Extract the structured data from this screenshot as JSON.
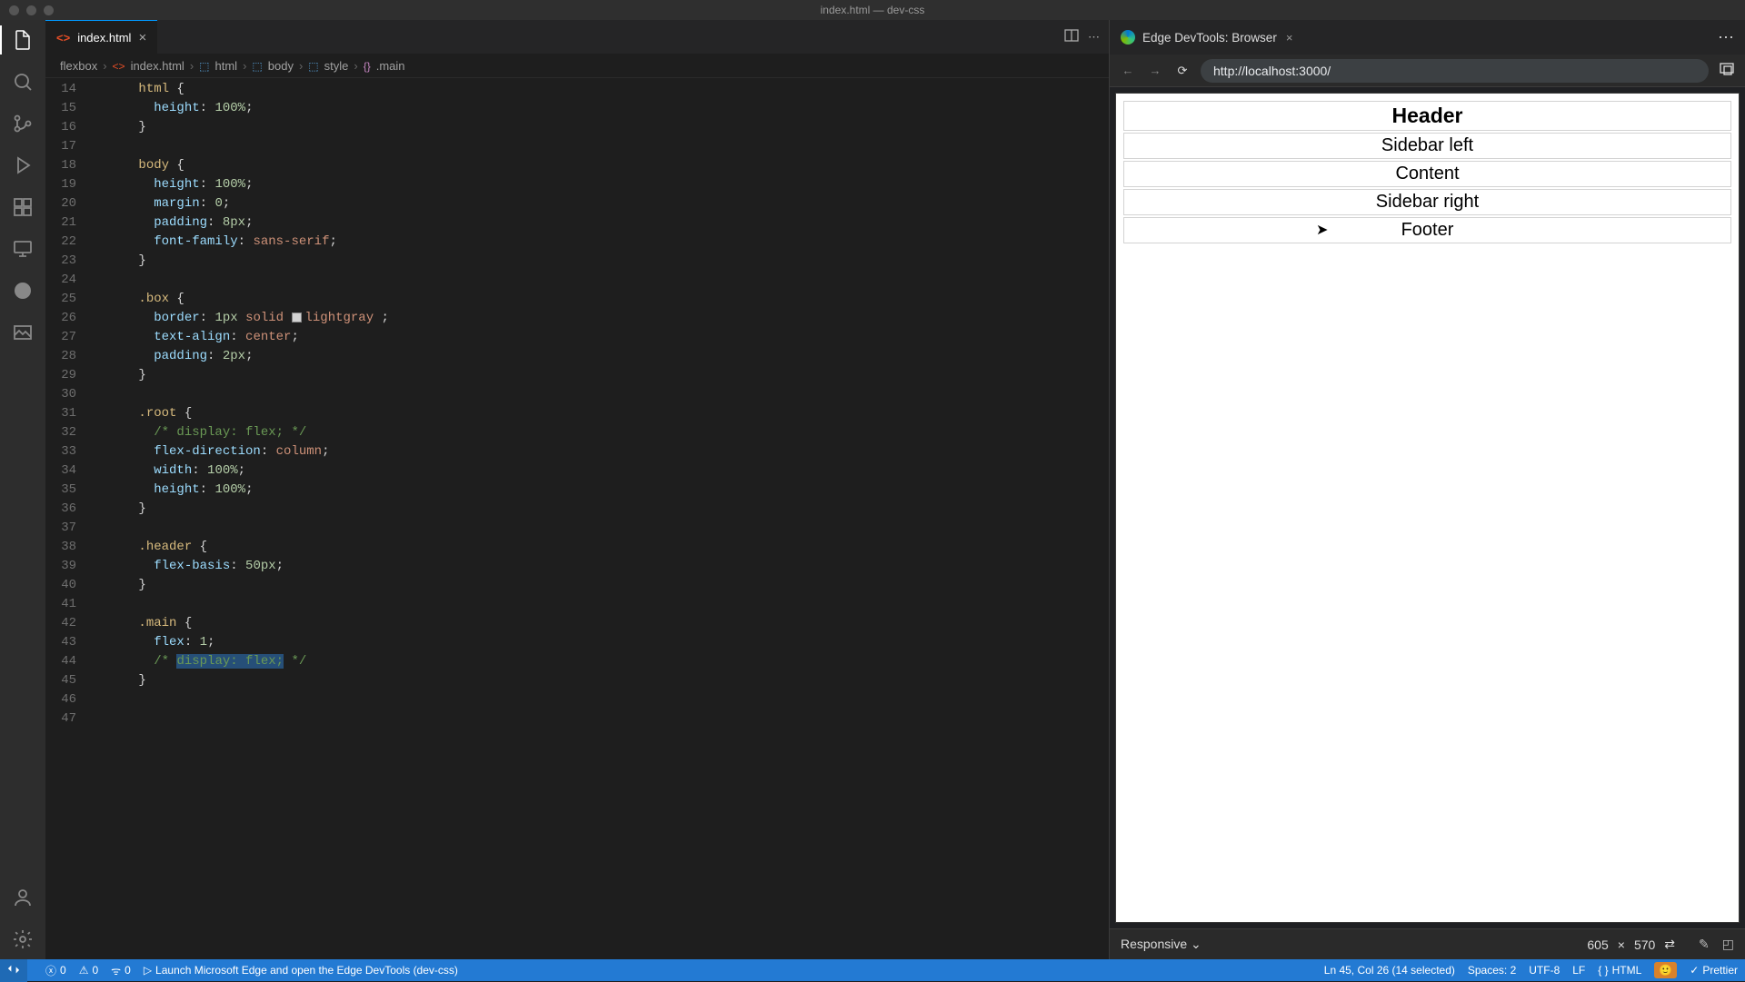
{
  "window": {
    "title": "index.html — dev-css"
  },
  "tab": {
    "filename": "index.html"
  },
  "breadcrumbs": {
    "root": "flexbox",
    "file": "index.html",
    "path": [
      "html",
      "body",
      "style",
      ".main"
    ]
  },
  "gutter": {
    "start": 14,
    "end": 47
  },
  "code_tokens": {
    "l14": {
      "sel": "html",
      "brace": " {"
    },
    "l15": {
      "prop": "height",
      "colon": ": ",
      "num": "100%",
      "semi": ";"
    },
    "l16": {
      "brace": "}"
    },
    "l18": {
      "sel": "body",
      "brace": " {"
    },
    "l19": {
      "prop": "height",
      "colon": ": ",
      "num": "100%",
      "semi": ";"
    },
    "l20": {
      "prop": "margin",
      "colon": ": ",
      "num": "0",
      "semi": ";"
    },
    "l21": {
      "prop": "padding",
      "colon": ": ",
      "num": "8px",
      "semi": ";"
    },
    "l22": {
      "prop": "font-family",
      "colon": ": ",
      "val": "sans-serif",
      "semi": ";"
    },
    "l23": {
      "brace": "}"
    },
    "l25": {
      "sel": ".box",
      "brace": " {"
    },
    "l26": {
      "prop": "border",
      "colon": ": ",
      "num": "1px",
      "val1": "solid",
      "val2": "lightgray",
      "semi": " ;"
    },
    "l27": {
      "prop": "text-align",
      "colon": ": ",
      "val": "center",
      "semi": ";"
    },
    "l28": {
      "prop": "padding",
      "colon": ": ",
      "num": "2px",
      "semi": ";"
    },
    "l29": {
      "brace": "}"
    },
    "l31": {
      "sel": ".root",
      "brace": " {"
    },
    "l32": {
      "comment": "/* display: flex; */"
    },
    "l33": {
      "prop": "flex-direction",
      "colon": ": ",
      "val": "column",
      "semi": ";"
    },
    "l34": {
      "prop": "width",
      "colon": ": ",
      "num": "100%",
      "semi": ";"
    },
    "l35": {
      "prop": "height",
      "colon": ": ",
      "num": "100%",
      "semi": ";"
    },
    "l36": {
      "brace": "}"
    },
    "l38": {
      "sel": ".header",
      "brace": " {"
    },
    "l39": {
      "prop": "flex-basis",
      "colon": ": ",
      "num": "50px",
      "semi": ";"
    },
    "l40": {
      "brace": "}"
    },
    "l42": {
      "sel": ".main",
      "brace": " {"
    },
    "l43": {
      "prop": "flex",
      "colon": ": ",
      "num": "1",
      "semi": ";"
    },
    "l44": {
      "comment_pre": "/* ",
      "comment_sel": "display: flex;",
      "comment_post": " */"
    },
    "l45": {
      "brace": "}"
    }
  },
  "devtools": {
    "tab_label": "Edge DevTools: Browser",
    "url": "http://localhost:3000/",
    "boxes": [
      "Header",
      "Sidebar left",
      "Content",
      "Sidebar right",
      "Footer"
    ],
    "device_label": "Responsive",
    "width": "605",
    "height": "570"
  },
  "statusbar": {
    "errors": "0",
    "warnings": "0",
    "ports": "0",
    "launch_msg": "Launch Microsoft Edge and open the Edge DevTools (dev-css)",
    "cursor": "Ln 45, Col 26 (14 selected)",
    "spaces": "Spaces: 2",
    "encoding": "UTF-8",
    "eol": "LF",
    "lang": "HTML",
    "prettier": "Prettier"
  }
}
